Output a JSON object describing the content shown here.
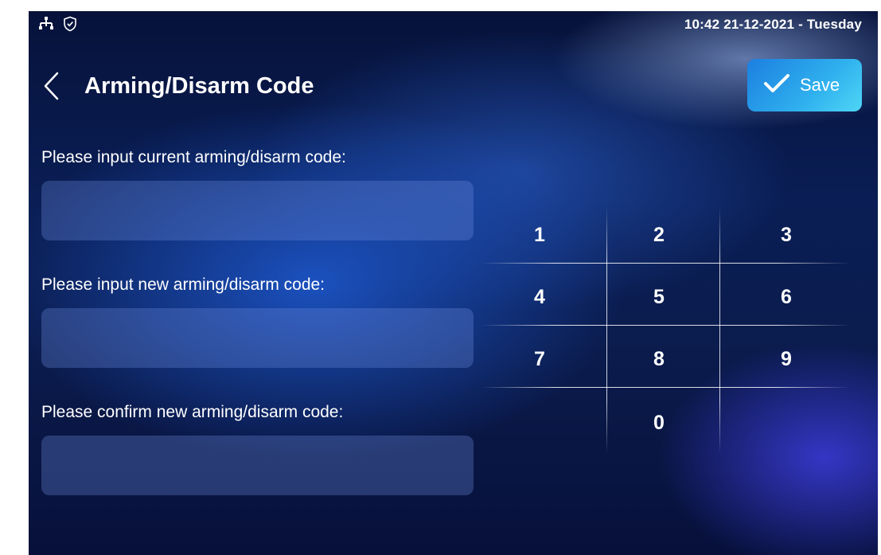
{
  "status_bar": {
    "datetime": "10:42  21-12-2021 - Tuesday",
    "icons": [
      "network-icon",
      "shield-check-icon"
    ]
  },
  "header": {
    "title": "Arming/Disarm Code",
    "back_icon": "chevron-left-icon",
    "save_label": "Save",
    "save_icon": "check-icon"
  },
  "form": {
    "current_label": "Please input current arming/disarm code:",
    "current_value": "",
    "new_label": "Please input new arming/disarm code:",
    "new_value": "",
    "confirm_label": "Please confirm new arming/disarm code:",
    "confirm_value": ""
  },
  "keypad": {
    "keys": [
      "1",
      "2",
      "3",
      "4",
      "5",
      "6",
      "7",
      "8",
      "9",
      "0"
    ]
  },
  "colors": {
    "save_button": "#2a9fe8",
    "background": "#0a1e55",
    "input_fill": "#4a6ab8"
  }
}
